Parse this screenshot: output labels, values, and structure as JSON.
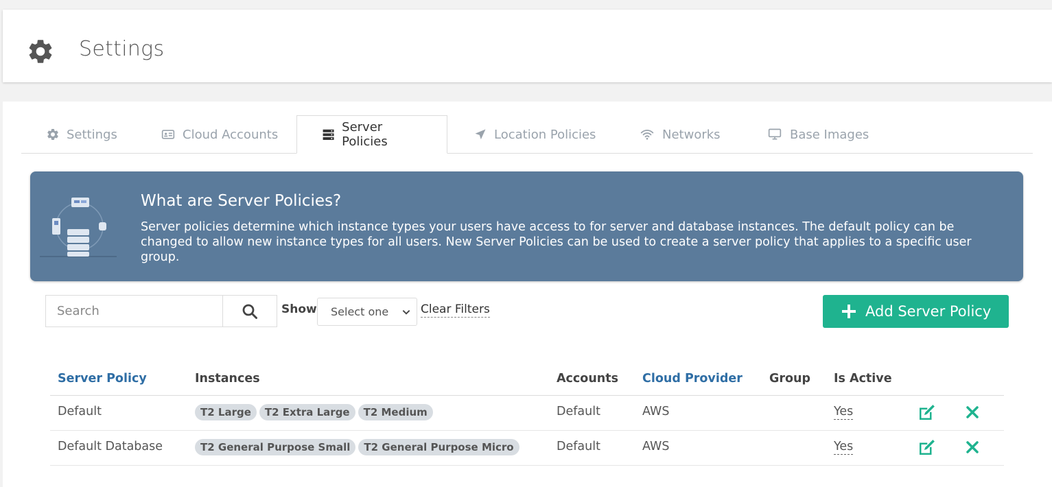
{
  "header": {
    "title": "Settings",
    "icon": "gear-icon"
  },
  "tabs": [
    {
      "label": "Settings",
      "icon": "gear-icon"
    },
    {
      "label": "Cloud Accounts",
      "icon": "id-card-icon"
    },
    {
      "label": "Server Policies",
      "icon": "server-icon",
      "active": true
    },
    {
      "label": "Location Policies",
      "icon": "location-arrow-icon"
    },
    {
      "label": "Networks",
      "icon": "wifi-icon"
    },
    {
      "label": "Base Images",
      "icon": "monitor-icon"
    }
  ],
  "banner": {
    "title": "What are Server Policies?",
    "text": "Server policies determine which instance types your users have access to for server and database instances. The default policy can be changed to allow new instance types for all users. New Server Policies can be used to create a server policy that applies to a specific user group."
  },
  "filters": {
    "search_placeholder": "Search",
    "show_label": "Show",
    "select_value": "Select one",
    "clear_label": "Clear Filters"
  },
  "add_button": {
    "label": "Add Server Policy"
  },
  "table": {
    "columns": [
      "Server Policy",
      "Instances",
      "Accounts",
      "Cloud Provider",
      "Group",
      "Is Active"
    ],
    "rows": [
      {
        "policy": "Default",
        "instances": [
          "T2 Large",
          "T2 Extra Large",
          "T2 Medium"
        ],
        "accounts": "Default",
        "provider": "AWS",
        "group": "",
        "active": "Yes"
      },
      {
        "policy": "Default Database",
        "instances": [
          "T2 General Purpose Small",
          "T2 General Purpose Micro"
        ],
        "accounts": "Default",
        "provider": "AWS",
        "group": "",
        "active": "Yes"
      }
    ]
  },
  "colors": {
    "banner": "#5b7b9b",
    "accent": "#1fb38f",
    "link": "#2f6ea5"
  }
}
